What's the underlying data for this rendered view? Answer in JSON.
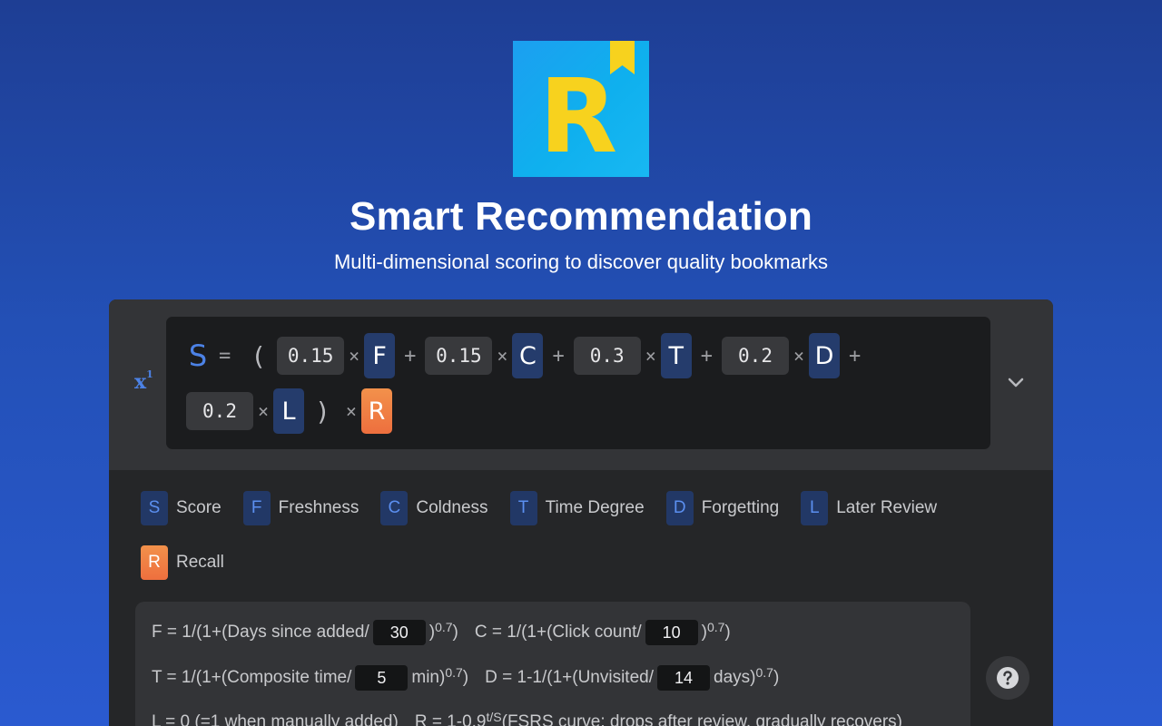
{
  "header": {
    "logo_letter": "R",
    "title": "Smart Recommendation",
    "subtitle": "Multi-dimensional scoring to discover quality bookmarks"
  },
  "formula": {
    "icon": "formula-icon",
    "lhs": "S",
    "equals": "=",
    "open_paren": "(",
    "close_paren": ")",
    "times": "×",
    "plus": "+",
    "terms": [
      {
        "weight": "0.15",
        "var": "F"
      },
      {
        "weight": "0.15",
        "var": "C"
      },
      {
        "weight": "0.3",
        "var": "T"
      },
      {
        "weight": "0.2",
        "var": "D"
      },
      {
        "weight": "0.2",
        "var": "L"
      }
    ],
    "multiplier": "R"
  },
  "legend": [
    {
      "letter": "S",
      "label": "Score"
    },
    {
      "letter": "F",
      "label": "Freshness"
    },
    {
      "letter": "C",
      "label": "Coldness"
    },
    {
      "letter": "T",
      "label": "Time Degree"
    },
    {
      "letter": "D",
      "label": "Forgetting"
    },
    {
      "letter": "L",
      "label": "Later Review"
    },
    {
      "letter": "R",
      "label": "Recall"
    }
  ],
  "details": {
    "f_prefix": "F = 1/(1+(",
    "f_label": "Days since added",
    "f_value": "30",
    "c_prefix": "C = 1/(1+(",
    "c_label": "Click count",
    "c_value": "10",
    "t_prefix": "T = 1/(1+(",
    "t_label": "Composite time",
    "t_value": "5",
    "t_unit": "min",
    "d_prefix": "D = 1-1/(1+(",
    "d_label": "Unvisited",
    "d_value": "14",
    "d_unit": "days",
    "slash": "/",
    "power_close": ")",
    "power": "0.7",
    "close": ")",
    "l_text": "L = 0 (=1 when manually added)",
    "r_prefix": "R = 1-0.9",
    "r_exp": "t/S",
    "r_text": " (FSRS curve: drops after review, gradually recovers)"
  },
  "colors": {
    "accent_blue": "#4c82e6",
    "recall_orange": "#ee6f3e",
    "logo_yellow": "#f7d21e"
  }
}
